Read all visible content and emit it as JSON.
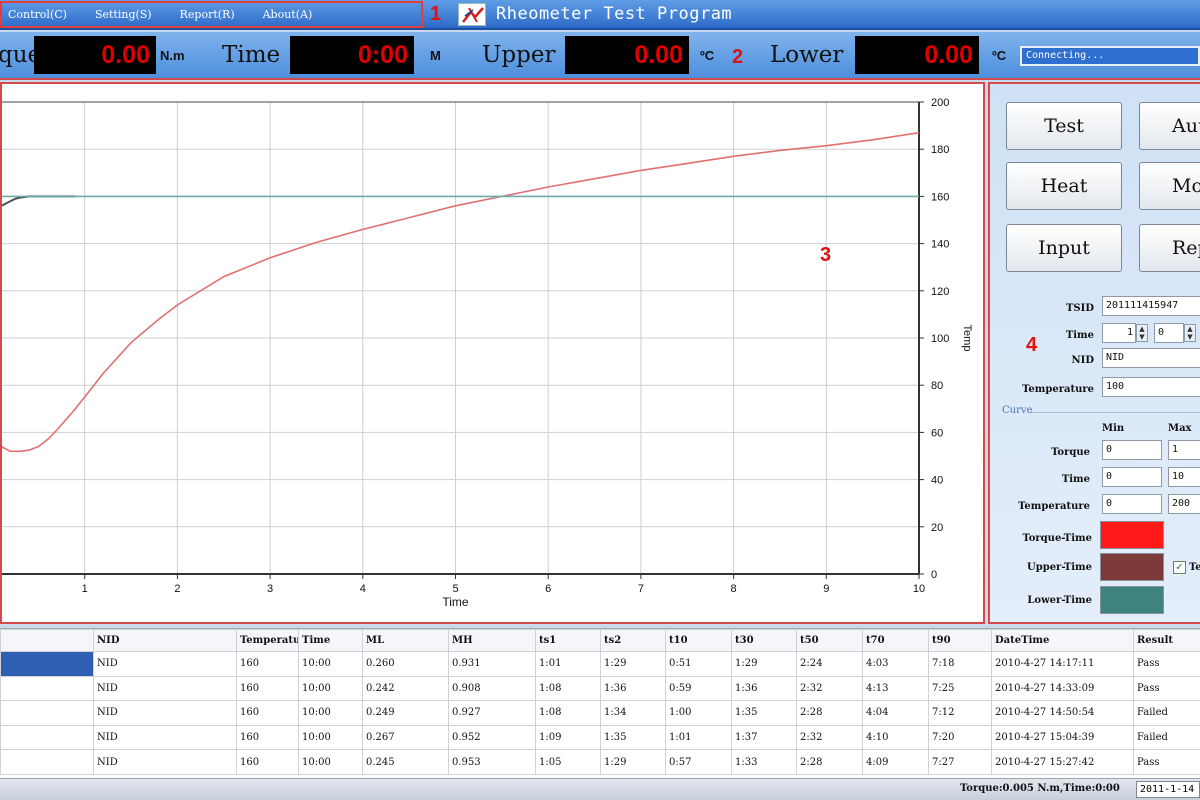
{
  "titlebar": {
    "menu": [
      "Control(C)",
      "Setting(S)",
      "Report(R)",
      "About(A)"
    ],
    "app_title": "Rheometer Test Program",
    "callouts": [
      "1",
      "2",
      "3",
      "4"
    ]
  },
  "readout": {
    "torque_label": "que",
    "torque_value": "0.00",
    "torque_unit": "N.m",
    "time_label": "Time",
    "time_value": "0:00",
    "time_unit": "M",
    "upper_label": "Upper",
    "upper_value": "0.00",
    "upper_unit": "ºC",
    "lower_label": "Lower",
    "lower_value": "0.00",
    "lower_unit": "ºC",
    "status": "Connecting..."
  },
  "chart_data": {
    "type": "line",
    "xlabel": "Time",
    "ylabel_right": "Temp",
    "xlim": [
      0,
      10
    ],
    "ylim": [
      0,
      200
    ],
    "x_ticks": [
      1,
      2,
      3,
      4,
      5,
      6,
      7,
      8,
      9,
      10
    ],
    "y_ticks": [
      0,
      20,
      40,
      60,
      80,
      100,
      120,
      140,
      160,
      180,
      200
    ],
    "grid": true,
    "series": [
      {
        "color": "#e07070",
        "x": [
          0,
          0.1,
          0.2,
          0.3,
          0.4,
          0.5,
          0.6,
          0.7,
          0.8,
          0.9,
          1.0,
          1.2,
          1.5,
          1.8,
          2.0,
          2.5,
          3.0,
          3.5,
          4.0,
          4.5,
          5.0,
          5.5,
          6.0,
          6.5,
          7.0,
          7.5,
          8.0,
          8.5,
          9.0,
          9.5,
          10.0
        ],
        "y": [
          65,
          54,
          52,
          52,
          52.5,
          54,
          57,
          61,
          65.5,
          70,
          75,
          85,
          98,
          108,
          114,
          126,
          134,
          140.5,
          146,
          151,
          156,
          160,
          164,
          167.5,
          171,
          174,
          177,
          179.5,
          181.5,
          184,
          187
        ]
      },
      {
        "color": "#505050",
        "x": [
          0,
          0.1,
          0.15,
          0.2,
          0.25,
          0.3,
          0.4,
          0.5,
          0.6,
          0.7,
          0.8,
          0.9
        ],
        "y": [
          155,
          156,
          157,
          158,
          159,
          159.5,
          160,
          160,
          160,
          160,
          160,
          160
        ]
      },
      {
        "color": "#6aaea8",
        "x": [
          0,
          10
        ],
        "y": [
          160,
          160
        ]
      }
    ]
  },
  "controls": {
    "buttons": [
      "Test",
      "Aut",
      "Heat",
      "Mot",
      "Input",
      "Repo"
    ],
    "tsid_label": "TSID",
    "tsid_value": "201111415947",
    "time_label": "Time",
    "time_value1": "1",
    "time_value2": "0",
    "nid_label": "NID",
    "nid_value": "NID",
    "temperature_label": "Temperature",
    "temperature_value": "100",
    "curve_title": "Curve",
    "min_header": "Min",
    "max_header": "Max",
    "curve_rows": [
      {
        "label": "Torque",
        "min": "0",
        "max": "1"
      },
      {
        "label": "Time",
        "min": "0",
        "max": "10"
      },
      {
        "label": "Temperature",
        "min": "0",
        "max": "200"
      }
    ],
    "legend": [
      {
        "label": "Torque-Time",
        "color": "#ff1a1a"
      },
      {
        "label": "Upper-Time",
        "color": "#7d3a3a"
      },
      {
        "label": "Lower-Time",
        "color": "#3f847c"
      }
    ],
    "checkbox_label": "Te"
  },
  "table": {
    "headers": [
      "",
      "NID",
      "Temperatu",
      "Time",
      "ML",
      "MH",
      "ts1",
      "ts2",
      "t10",
      "t30",
      "t50",
      "t70",
      "t90",
      "DateTime",
      "Result"
    ],
    "rows": [
      [
        "",
        "NID",
        "160",
        "10:00",
        "0.260",
        "0.931",
        "1:01",
        "1:29",
        "0:51",
        "1:29",
        "2:24",
        "4:03",
        "7:18",
        "2010-4-27 14:17:11",
        "Pass"
      ],
      [
        "",
        "NID",
        "160",
        "10:00",
        "0.242",
        "0.908",
        "1:08",
        "1:36",
        "0:59",
        "1:36",
        "2:32",
        "4:13",
        "7:25",
        "2010-4-27 14:33:09",
        "Pass"
      ],
      [
        "",
        "NID",
        "160",
        "10:00",
        "0.249",
        "0.927",
        "1:08",
        "1:34",
        "1:00",
        "1:35",
        "2:28",
        "4:04",
        "7:12",
        "2010-4-27 14:50:54",
        "Failed"
      ],
      [
        "",
        "NID",
        "160",
        "10:00",
        "0.267",
        "0.952",
        "1:09",
        "1:35",
        "1:01",
        "1:37",
        "2:32",
        "4:10",
        "7:20",
        "2010-4-27 15:04:39",
        "Failed"
      ],
      [
        "",
        "NID",
        "160",
        "10:00",
        "0.245",
        "0.953",
        "1:05",
        "1:29",
        "0:57",
        "1:33",
        "2:28",
        "4:09",
        "7:27",
        "2010-4-27 15:27:42",
        "Pass"
      ]
    ]
  },
  "statusbar": {
    "text": "Torque:0.005 N.m,Time:0:00",
    "date": "2011-1-14"
  }
}
